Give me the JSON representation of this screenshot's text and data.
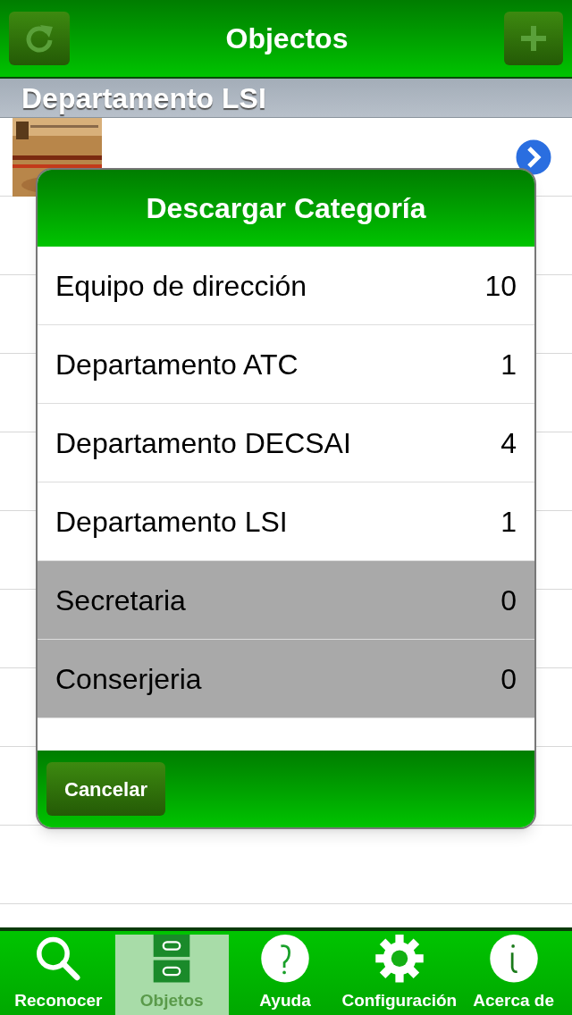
{
  "nav": {
    "title": "Objectos"
  },
  "section": {
    "title": "Departamento LSI"
  },
  "dialog": {
    "title": "Descargar Categoría",
    "items": [
      {
        "label": "Equipo de dirección",
        "count": "10",
        "disabled": false
      },
      {
        "label": "Departamento ATC",
        "count": "1",
        "disabled": false
      },
      {
        "label": "Departamento DECSAI",
        "count": "4",
        "disabled": false
      },
      {
        "label": "Departamento LSI",
        "count": "1",
        "disabled": false
      },
      {
        "label": "Secretaria",
        "count": "0",
        "disabled": true
      },
      {
        "label": "Conserjeria",
        "count": "0",
        "disabled": true
      }
    ],
    "cancel": "Cancelar"
  },
  "tabs": [
    {
      "label": "Reconocer",
      "selected": false
    },
    {
      "label": "Objetos",
      "selected": true
    },
    {
      "label": "Ayuda",
      "selected": false
    },
    {
      "label": "Configuración",
      "selected": false
    },
    {
      "label": "Acerca de",
      "selected": false
    }
  ]
}
